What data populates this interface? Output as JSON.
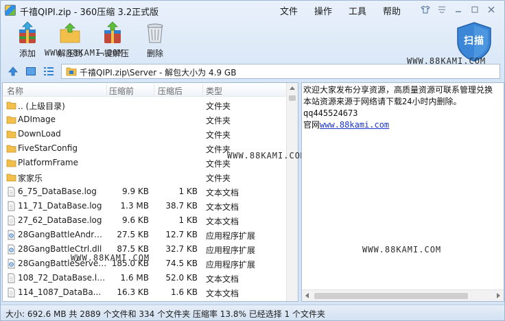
{
  "window": {
    "title": "千禧QIPI.zip - 360压缩 3.2正式版",
    "menus": [
      "文件",
      "操作",
      "工具",
      "帮助"
    ]
  },
  "toolbar": {
    "add_label": "添加",
    "extract_label": "解压到",
    "one_click_label": "一键解压",
    "delete_label": "删除",
    "scan_label": "扫描"
  },
  "address": {
    "path": "千禧QIPI.zip\\Server - 解包大小为 4.9 GB"
  },
  "list": {
    "headers": {
      "name": "名称",
      "size": "压缩前",
      "compressed": "压缩后",
      "type": "类型"
    },
    "rows": [
      {
        "icon": "folder-icon",
        "name": ".. (上级目录)",
        "size": "",
        "compressed": "",
        "type": "文件夹"
      },
      {
        "icon": "folder-icon",
        "name": "ADImage",
        "size": "",
        "compressed": "",
        "type": "文件夹"
      },
      {
        "icon": "folder-icon",
        "name": "DownLoad",
        "size": "",
        "compressed": "",
        "type": "文件夹"
      },
      {
        "icon": "folder-icon",
        "name": "FiveStarConfig",
        "size": "",
        "compressed": "",
        "type": "文件夹"
      },
      {
        "icon": "folder-icon",
        "name": "PlatformFrame",
        "size": "",
        "compressed": "",
        "type": "文件夹"
      },
      {
        "icon": "folder-icon",
        "name": "家家乐",
        "size": "",
        "compressed": "",
        "type": "文件夹"
      },
      {
        "icon": "text-file-icon",
        "name": "6_75_DataBase.log",
        "size": "9.9 KB",
        "compressed": "1 KB",
        "type": "文本文档"
      },
      {
        "icon": "text-file-icon",
        "name": "11_71_DataBase.log",
        "size": "1.3 MB",
        "compressed": "38.7 KB",
        "type": "文本文档"
      },
      {
        "icon": "text-file-icon",
        "name": "27_62_DataBase.log",
        "size": "9.6 KB",
        "compressed": "1 KB",
        "type": "文本文档"
      },
      {
        "icon": "dll-file-icon",
        "name": "28GangBattleAndroi...",
        "size": "27.5 KB",
        "compressed": "12.7 KB",
        "type": "应用程序扩展"
      },
      {
        "icon": "dll-file-icon",
        "name": "28GangBattleCtrl.dll",
        "size": "87.5 KB",
        "compressed": "32.7 KB",
        "type": "应用程序扩展"
      },
      {
        "icon": "dll-file-icon",
        "name": "28GangBattleServer...",
        "size": "185.0 KB",
        "compressed": "74.5 KB",
        "type": "应用程序扩展"
      },
      {
        "icon": "text-file-icon",
        "name": "108_72_DataBase.log",
        "size": "1.6 MB",
        "compressed": "52.0 KB",
        "type": "文本文档"
      },
      {
        "icon": "text-file-icon",
        "name": "114_1087_DataBa...",
        "size": "16.3 KB",
        "compressed": "1.6 KB",
        "type": "文本文档"
      }
    ]
  },
  "preview": {
    "line1": "欢迎大家发布分享资源，高质量资源可联系管理兑换",
    "line2": "本站资源来源于网络请下载24小时内删除。",
    "line3": "qq445524673",
    "line4_prefix": "官网",
    "line4_link": "www.88kami.com"
  },
  "watermarks": {
    "text": "WWW.88KAMI.COM"
  },
  "status": {
    "text": "大小: 692.6 MB 共 2889 个文件和 334 个文件夹 压缩率 13.8% 已经选择 1 个文件夹"
  },
  "colors": {
    "accent": "#2f7fd0",
    "link": "#1a35c8",
    "folder": "#f2c04a"
  }
}
